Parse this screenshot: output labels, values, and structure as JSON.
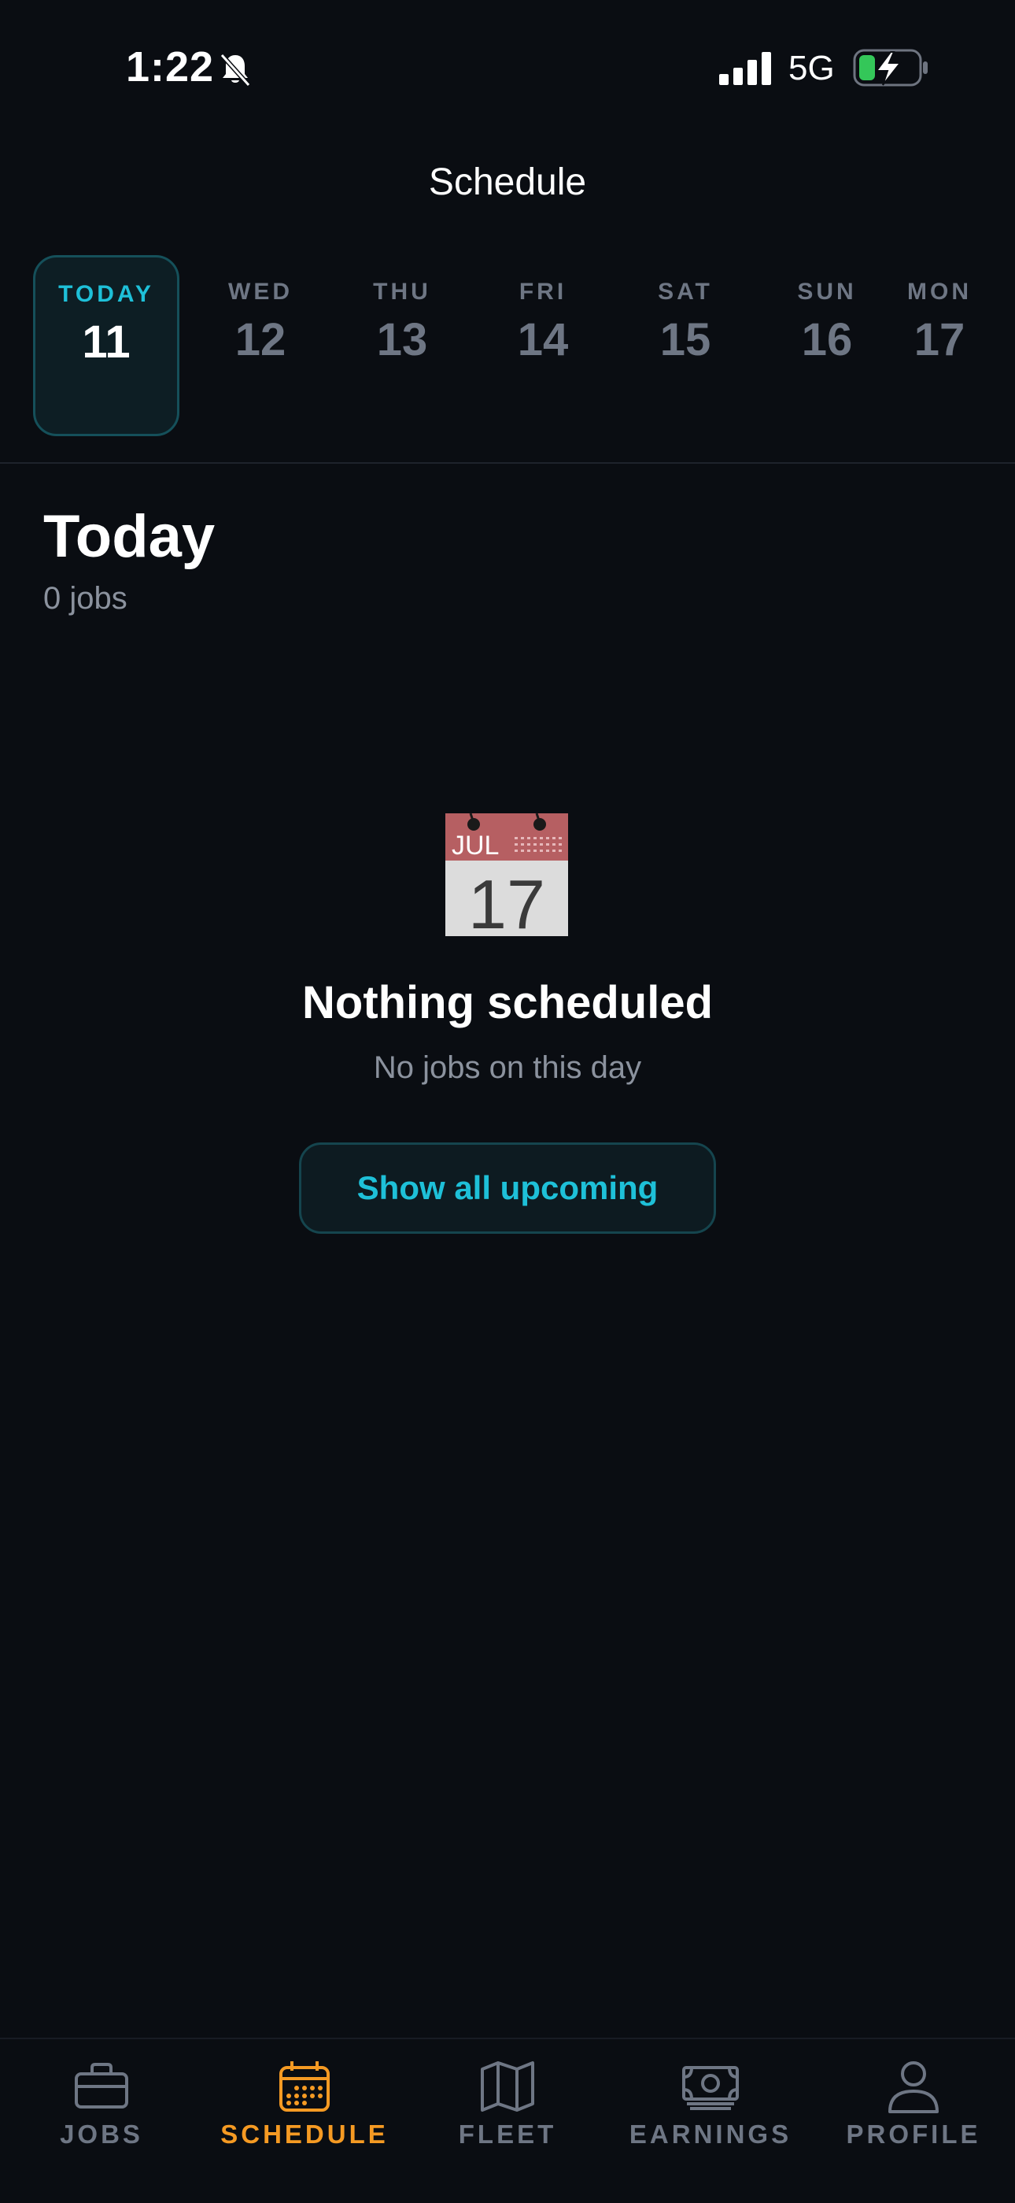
{
  "status_bar": {
    "time": "1:22",
    "network": "5G"
  },
  "header": {
    "title": "Schedule"
  },
  "days": [
    {
      "label": "TODAY",
      "num": "11"
    },
    {
      "label": "WED",
      "num": "12"
    },
    {
      "label": "THU",
      "num": "13"
    },
    {
      "label": "FRI",
      "num": "14"
    },
    {
      "label": "SAT",
      "num": "15"
    },
    {
      "label": "SUN",
      "num": "16"
    },
    {
      "label": "MON",
      "num": "17"
    }
  ],
  "section": {
    "title": "Today",
    "subtitle": "0 jobs"
  },
  "empty_state": {
    "icon": "calendar-emoji",
    "icon_month": "JUL",
    "icon_day": "17",
    "title": "Nothing scheduled",
    "subtitle": "No jobs on this day",
    "button_label": "Show all upcoming"
  },
  "tabs": [
    {
      "label": "JOBS",
      "icon": "briefcase-icon"
    },
    {
      "label": "SCHEDULE",
      "icon": "calendar-icon"
    },
    {
      "label": "FLEET",
      "icon": "map-icon"
    },
    {
      "label": "EARNINGS",
      "icon": "cash-icon"
    },
    {
      "label": "PROFILE",
      "icon": "person-icon"
    }
  ],
  "colors": {
    "accent": "#1ec0d8",
    "active_tab": "#f59a23",
    "background": "#0a0d12"
  }
}
